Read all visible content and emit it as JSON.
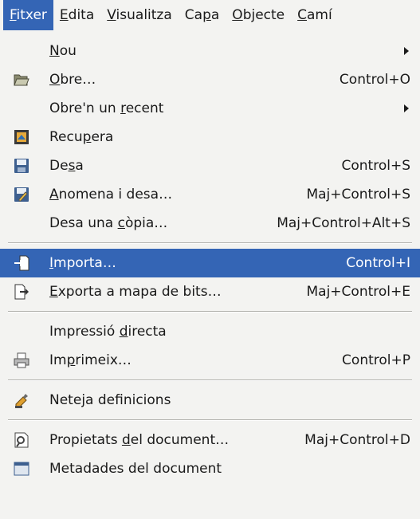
{
  "menubar": [
    {
      "pre": "",
      "m": "F",
      "post": "itxer",
      "active": true
    },
    {
      "pre": "",
      "m": "E",
      "post": "dita",
      "active": false
    },
    {
      "pre": "",
      "m": "V",
      "post": "isualitza",
      "active": false
    },
    {
      "pre": "Ca",
      "m": "p",
      "post": "a",
      "active": false
    },
    {
      "pre": "",
      "m": "O",
      "post": "bjecte",
      "active": false
    },
    {
      "pre": "",
      "m": "C",
      "post": "amí",
      "active": false
    }
  ],
  "menu": [
    {
      "pre": "",
      "m": "N",
      "post": "ou",
      "shortcut": "",
      "submenu": true,
      "icon": "",
      "icon_name": ""
    },
    {
      "pre": "",
      "m": "O",
      "post": "bre…",
      "shortcut": "Control+O",
      "submenu": false,
      "icon": "folder",
      "icon_name": "open-folder-icon"
    },
    {
      "pre": "Obre'n un ",
      "m": "r",
      "post": "ecent",
      "shortcut": "",
      "submenu": true,
      "icon": "",
      "icon_name": ""
    },
    {
      "pre": "Recu",
      "m": "p",
      "post": "era",
      "shortcut": "",
      "submenu": false,
      "icon": "recover",
      "icon_name": "recover-icon"
    },
    {
      "pre": "De",
      "m": "s",
      "post": "a",
      "shortcut": "Control+S",
      "submenu": false,
      "icon": "disk",
      "icon_name": "save-disk-icon"
    },
    {
      "pre": "",
      "m": "A",
      "post": "nomena i desa…",
      "shortcut": "Maj+Control+S",
      "submenu": false,
      "icon": "saveas",
      "icon_name": "save-as-icon"
    },
    {
      "pre": "Desa una ",
      "m": "c",
      "post": "òpia…",
      "shortcut": "Maj+Control+Alt+S",
      "submenu": false,
      "icon": "",
      "icon_name": ""
    },
    {
      "separator": true
    },
    {
      "pre": "",
      "m": "I",
      "post": "mporta…",
      "shortcut": "Control+I",
      "submenu": false,
      "icon": "import",
      "icon_name": "import-icon",
      "highlight": true
    },
    {
      "pre": "",
      "m": "E",
      "post": "xporta a mapa de bits…",
      "shortcut": "Maj+Control+E",
      "submenu": false,
      "icon": "export",
      "icon_name": "export-icon"
    },
    {
      "separator": true
    },
    {
      "pre": "Impressió ",
      "m": "d",
      "post": "irecta",
      "shortcut": "",
      "submenu": false,
      "icon": "",
      "icon_name": ""
    },
    {
      "pre": "Im",
      "m": "p",
      "post": "rimeix…",
      "shortcut": "Control+P",
      "submenu": false,
      "icon": "printer",
      "icon_name": "printer-icon"
    },
    {
      "separator": true
    },
    {
      "pre": "Nete",
      "m": "j",
      "post": "a definicions",
      "shortcut": "",
      "submenu": false,
      "icon": "clean",
      "icon_name": "clean-definitions-icon"
    },
    {
      "separator": true
    },
    {
      "pre": "Propietats ",
      "m": "d",
      "post": "el document…",
      "shortcut": "Maj+Control+D",
      "submenu": false,
      "icon": "props",
      "icon_name": "document-properties-icon"
    },
    {
      "pre": "Metadades del document",
      "m": "",
      "post": "",
      "shortcut": "",
      "submenu": false,
      "icon": "meta",
      "icon_name": "document-metadata-icon"
    }
  ]
}
